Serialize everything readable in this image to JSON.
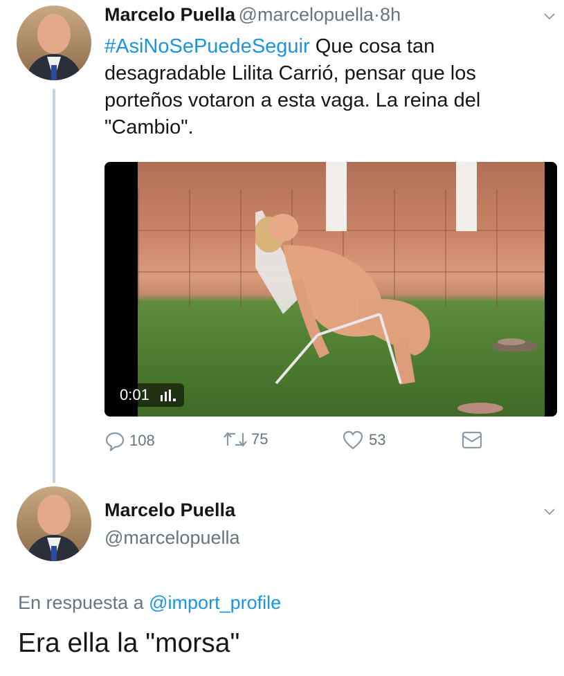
{
  "tweet": {
    "author_name": "Marcelo Puella",
    "author_handle": "@marcelopuella",
    "dot": "·",
    "age": "8h",
    "hashtag": "#AsiNoSePuedeSeguir",
    "text": " Que cosa tan desagradable Lilita Carrió, pensar que los porteños votaron a esta vaga. La reina del \"Cambio\".",
    "video_time": "0:01",
    "counts": {
      "replies": "108",
      "retweets": "75",
      "likes": "53"
    }
  },
  "reply": {
    "author_name": "Marcelo Puella",
    "author_handle": "@marcelopuella",
    "in_reply_prefix": "En respuesta a",
    "in_reply_handle": "@import_profile",
    "text": "Era ella la \"morsa\""
  },
  "colors": {
    "link": "#1b95e0",
    "muted": "#66757f",
    "thread_line": "#c7d1da"
  },
  "icons": [
    "chevron-down-icon",
    "reply-icon",
    "retweet-icon",
    "like-icon",
    "dm-icon",
    "volume-bars-icon"
  ]
}
